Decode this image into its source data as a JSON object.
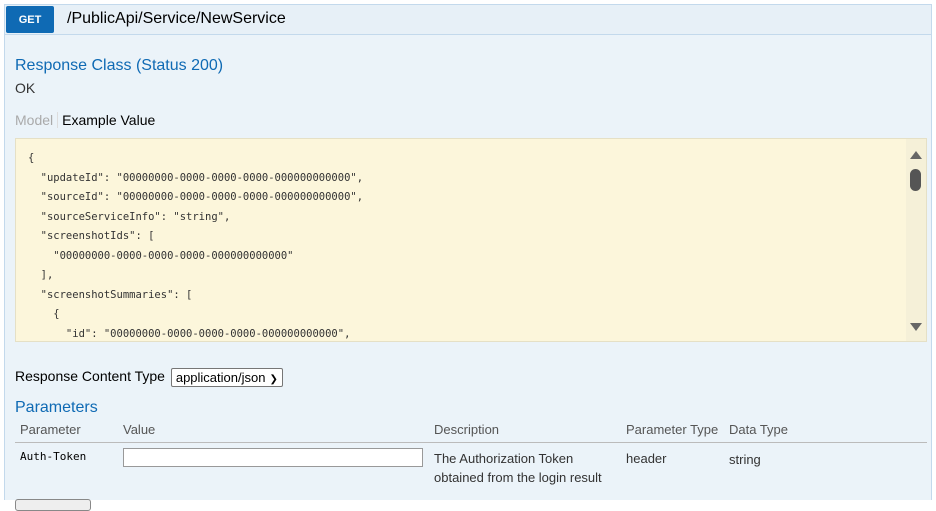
{
  "operation": {
    "method": "GET",
    "path": "/PublicApi/Service/NewService"
  },
  "response_class": {
    "title": "Response Class (Status 200)",
    "status_text": "OK",
    "tabs": {
      "model": "Model",
      "example": "Example Value"
    },
    "example_lines": [
      "{",
      "  \"updateId\": \"00000000-0000-0000-0000-000000000000\",",
      "  \"sourceId\": \"00000000-0000-0000-0000-000000000000\",",
      "  \"sourceServiceInfo\": \"string\",",
      "  \"screenshotIds\": [",
      "    \"00000000-0000-0000-0000-000000000000\"",
      "  ],",
      "  \"screenshotSummaries\": [",
      "    {",
      "      \"id\": \"00000000-0000-0000-0000-000000000000\","
    ]
  },
  "content_type": {
    "label": "Response Content Type",
    "selected": "application/json"
  },
  "parameters": {
    "title": "Parameters",
    "headers": [
      "Parameter",
      "Value",
      "Description",
      "Parameter Type",
      "Data Type"
    ],
    "rows": [
      {
        "name": "Auth-Token",
        "value": "",
        "description_line1": "The Authorization Token",
        "description_line2": "obtained from the login result",
        "param_type": "header",
        "data_type": "string"
      }
    ]
  },
  "colors": {
    "method_bg": "#0f6ab4",
    "panel_bg": "#ebf3f9",
    "code_bg": "#fcf6db",
    "heading": "#0f6ab4"
  }
}
